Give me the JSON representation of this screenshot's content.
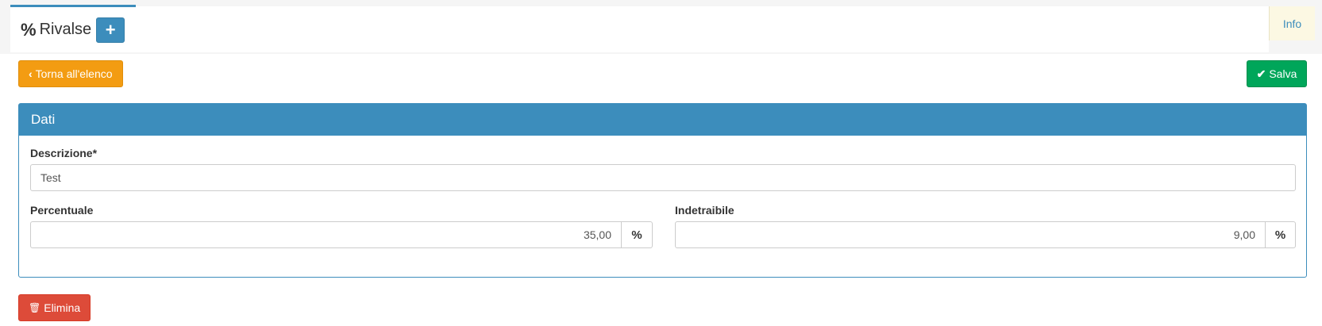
{
  "header": {
    "tab_icon": "%",
    "tab_title": "Rivalse",
    "add_label": "+",
    "info_label": "Info"
  },
  "toolbar": {
    "back_icon": "‹",
    "back_label": "Torna all'elenco",
    "save_icon": "✔",
    "save_label": "Salva"
  },
  "panel": {
    "title": "Dati",
    "descrizione_label": "Descrizione*",
    "descrizione_value": "Test",
    "percentuale_label": "Percentuale",
    "percentuale_value": "35,00",
    "percentuale_unit": "%",
    "indetraibile_label": "Indetraibile",
    "indetraibile_value": "9,00",
    "indetraibile_unit": "%"
  },
  "footer": {
    "delete_icon": "🗑",
    "delete_label": "Elimina"
  },
  "colors": {
    "primary": "#3c8dbc",
    "warning": "#f39c12",
    "success": "#00a65a",
    "danger": "#dd4b39"
  },
  "icons": {
    "percent": "percent-icon",
    "add": "plus-icon",
    "back": "chevron-left-icon",
    "save": "check-icon",
    "delete": "trash-icon"
  }
}
